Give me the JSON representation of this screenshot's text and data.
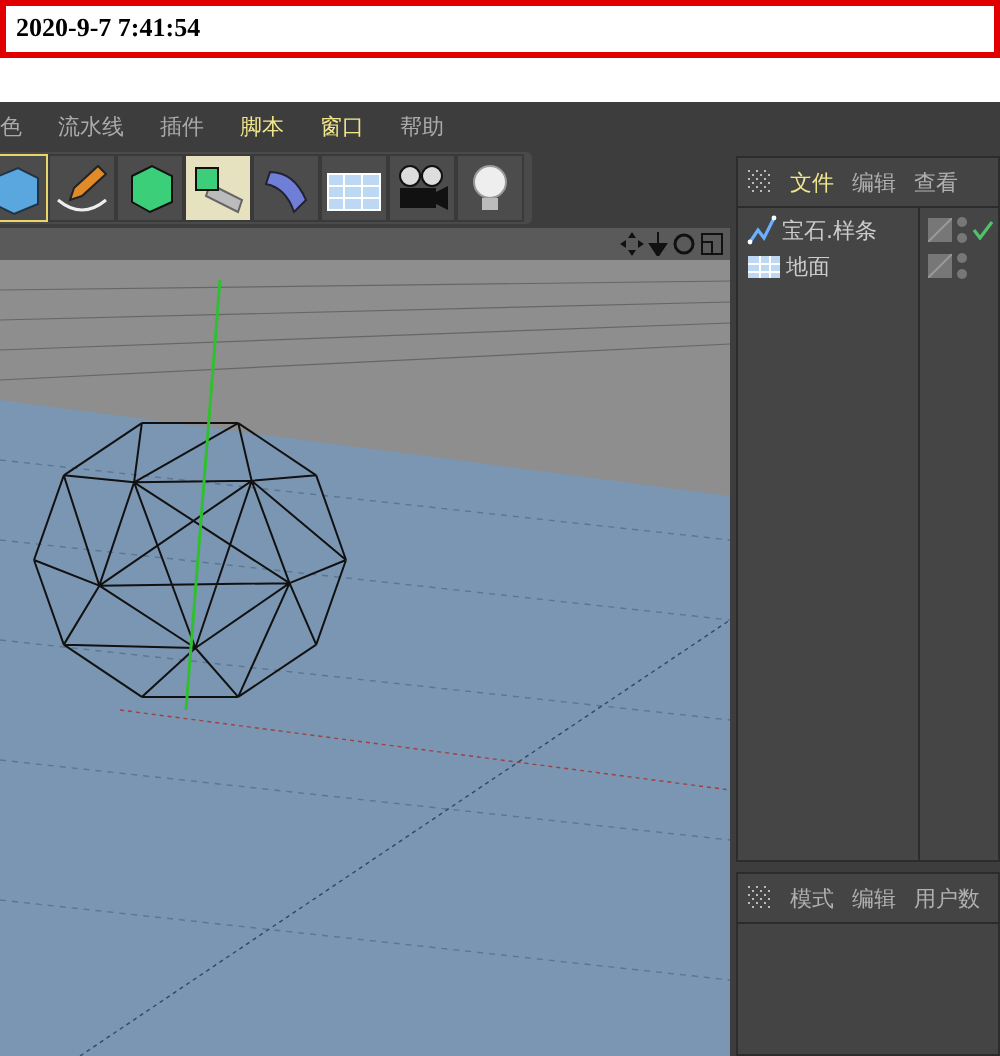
{
  "timestamp": "2020-9-7 7:41:54",
  "menu": [
    {
      "label": "色",
      "highlighted": false
    },
    {
      "label": "流水线",
      "highlighted": false
    },
    {
      "label": "插件",
      "highlighted": false
    },
    {
      "label": "脚本",
      "highlighted": true
    },
    {
      "label": "窗口",
      "highlighted": true
    },
    {
      "label": "帮助",
      "highlighted": false
    }
  ],
  "tools": [
    {
      "kind": "cube",
      "selected": true,
      "highlighted": false
    },
    {
      "kind": "pen",
      "selected": false,
      "highlighted": false
    },
    {
      "kind": "green-cube",
      "selected": false,
      "highlighted": false
    },
    {
      "kind": "array",
      "selected": false,
      "highlighted": true
    },
    {
      "kind": "bend",
      "selected": false,
      "highlighted": false
    },
    {
      "kind": "floor",
      "selected": false,
      "highlighted": false
    },
    {
      "kind": "camera",
      "selected": false,
      "highlighted": false
    },
    {
      "kind": "light",
      "selected": false,
      "highlighted": false
    }
  ],
  "object_manager": {
    "tabs": [
      {
        "label": "文件",
        "selected": true
      },
      {
        "label": "编辑",
        "selected": false
      },
      {
        "label": "查看",
        "selected": false
      }
    ],
    "objects": [
      {
        "kind": "spline",
        "name": "宝石.样条",
        "checked": true
      },
      {
        "kind": "floor",
        "name": "地面",
        "checked": false
      }
    ]
  },
  "attribute_manager": {
    "tabs": [
      {
        "label": "模式",
        "selected": false
      },
      {
        "label": "编辑",
        "selected": false
      },
      {
        "label": "用户数",
        "selected": false
      }
    ]
  }
}
